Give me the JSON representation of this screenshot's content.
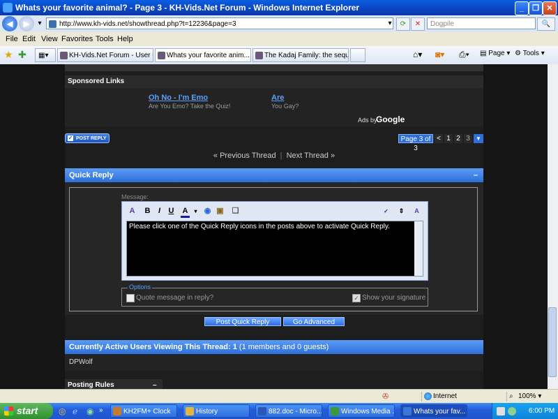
{
  "window": {
    "title": "Whats your favorite animal? - Page 3 - KH-Vids.Net Forum - Windows Internet Explorer"
  },
  "addressbar": {
    "url": "http://www.kh-vids.net/showthread.php?t=12236&page=3",
    "search_placeholder": "Dogpile"
  },
  "menubar": {
    "items": [
      "File",
      "Edit",
      "View",
      "Favorites",
      "Tools",
      "Help"
    ]
  },
  "tabs": [
    {
      "label": "KH-Vids.Net Forum - User Co..."
    },
    {
      "label": "Whats your favorite anim..."
    },
    {
      "label": "The Kadaj Family: the sequel..."
    }
  ],
  "commandbar": {
    "page_label": "Page",
    "tools_label": "Tools"
  },
  "sponsored": {
    "header": "Sponsored Links",
    "ads": [
      {
        "title": "Oh No - I'm Emo",
        "subtitle": "Are You Emo? Take the Quiz!"
      },
      {
        "title": "Are",
        "subtitle": "You Gay?"
      }
    ],
    "ads_by": "Ads by",
    "google": "Google"
  },
  "post_reply_label": "POST REPLY",
  "pager": {
    "label": "Page 3 of 3",
    "prev": "<",
    "pages": [
      "1",
      "2",
      "3"
    ],
    "menu": "▼"
  },
  "thread_nav": {
    "prev": "« Previous Thread",
    "sep": "|",
    "next": "Next Thread »"
  },
  "quick_reply": {
    "header": "Quick Reply",
    "collapse": "–",
    "message_label": "Message:",
    "editor_text": "Please click one of the Quick Reply icons in the posts above to activate Quick Reply.",
    "options_legend": "Options",
    "quote_label": "Quote message in reply?",
    "signature_label": "Show your signature",
    "signature_checked": true,
    "submit_label": "Post Quick Reply",
    "advanced_label": "Go Advanced"
  },
  "active_users": {
    "header_strong": "Currently Active Users Viewing This Thread: 1",
    "header_rest": "(1 members and 0 guests)",
    "users": [
      "DPWolf"
    ]
  },
  "posting_rules": {
    "header": "Posting Rules",
    "collapse": "–"
  },
  "statusbar": {
    "zone": "Internet",
    "zoom": "100%"
  },
  "taskbar": {
    "start": "start",
    "tasks": [
      {
        "label": "KH2FM+ Clock",
        "color": "#c97a2a"
      },
      {
        "label": "History",
        "color": "#e3b341"
      },
      {
        "label": "882.doc - Micro...",
        "color": "#2b58b8"
      },
      {
        "label": "Windows Media ...",
        "color": "#3a9a3a"
      },
      {
        "label": "Whats your fav...",
        "color": "#3a78d8",
        "active": true
      }
    ],
    "clock": "6:00 PM"
  },
  "colors": {
    "accent": "#2e6fd8",
    "link": "#5aa0ff",
    "page_bg": "#151515"
  }
}
